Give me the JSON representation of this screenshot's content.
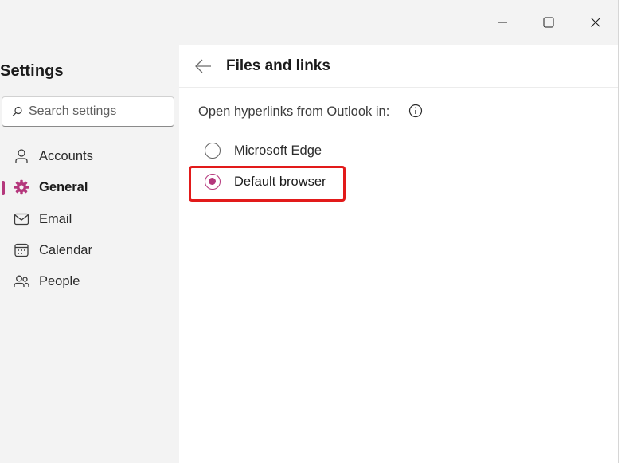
{
  "window": {
    "controls": {
      "minimize_icon": "minimize-icon",
      "maximize_icon": "maximize-icon",
      "close_icon": "close-icon"
    }
  },
  "sidebar": {
    "title": "Settings",
    "search": {
      "placeholder": "Search settings",
      "value": ""
    },
    "items": [
      {
        "label": "Accounts",
        "icon": "person-icon",
        "active": false
      },
      {
        "label": "General",
        "icon": "gear-icon",
        "active": true
      },
      {
        "label": "Email",
        "icon": "mail-icon",
        "active": false
      },
      {
        "label": "Calendar",
        "icon": "calendar-icon",
        "active": false
      },
      {
        "label": "People",
        "icon": "people-icon",
        "active": false
      }
    ]
  },
  "main": {
    "title": "Files and links",
    "setting_label": "Open hyperlinks from Outlook in:",
    "options": [
      {
        "label": "Microsoft Edge",
        "checked": false
      },
      {
        "label": "Default browser",
        "checked": true
      }
    ]
  },
  "colors": {
    "accent": "#b4377c",
    "highlight": "#e21a1a",
    "sidebar_bg": "#f3f3f3"
  }
}
